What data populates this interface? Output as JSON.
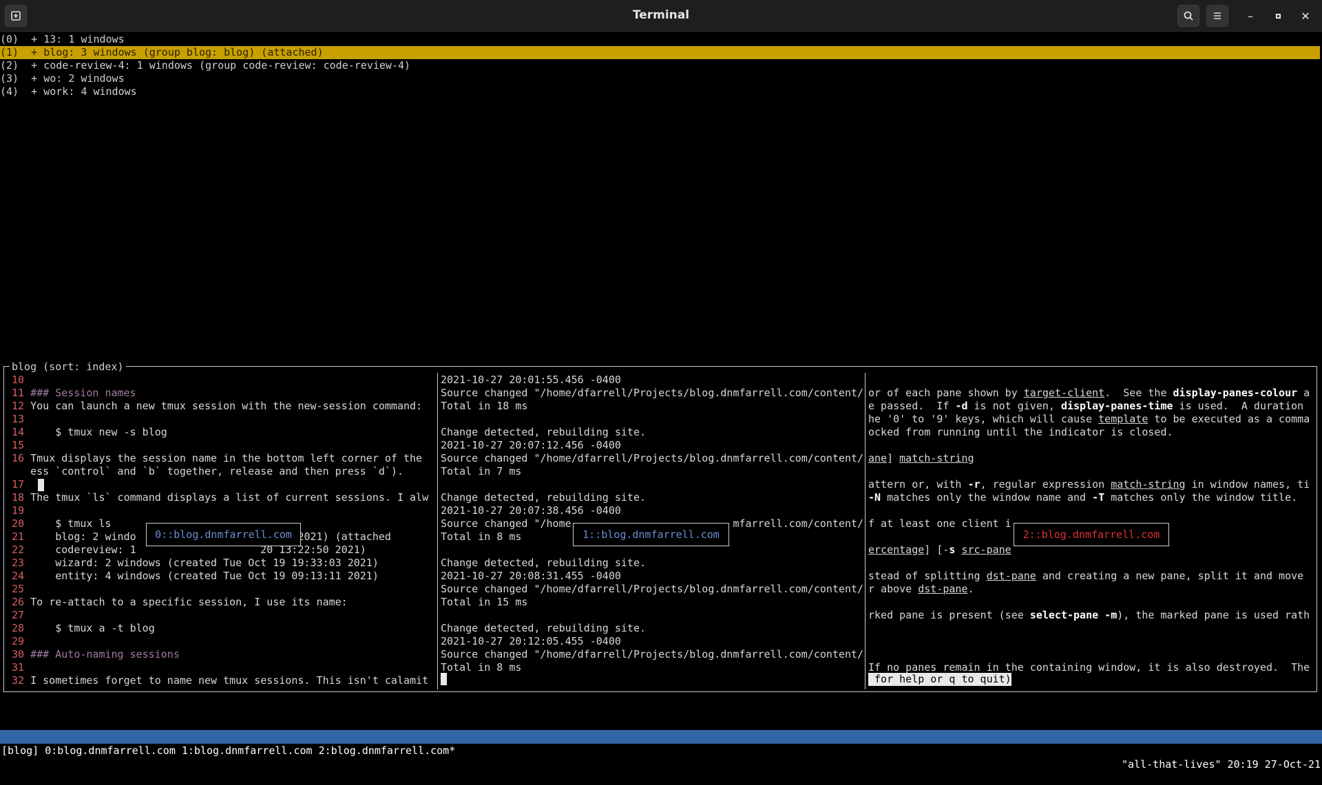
{
  "window": {
    "title": "Terminal"
  },
  "session_tree": [
    "(0)  + 13: 1 windows",
    "(1)  + blog: 3 windows (group blog: blog) (attached)",
    "(2)  + code-review-4: 1 windows (group code-review: code-review-4)",
    "(3)  + wo: 2 windows",
    "(4)  + work: 4 windows"
  ],
  "preview_title": "blog (sort: index)",
  "pane1": {
    "lines": [
      {
        "n": "10",
        "t": ""
      },
      {
        "n": "11",
        "t": "### Session names",
        "cls": "hd"
      },
      {
        "n": "12",
        "t": "You can launch a new tmux session with the new-session command:"
      },
      {
        "n": "13",
        "t": ""
      },
      {
        "n": "14",
        "t": "    $ tmux new -s blog"
      },
      {
        "n": "15",
        "t": ""
      },
      {
        "n": "16",
        "t": "Tmux displays the session name in the bottom left corner of the"
      },
      {
        "n": "",
        "t": "ess `control` and `b` together, release and then press `d`)."
      },
      {
        "n": "17",
        "t": ""
      },
      {
        "n": "18",
        "t": "The tmux `ls` command displays a list of current sessions. I alw"
      },
      {
        "n": "19",
        "t": ""
      },
      {
        "n": "20",
        "t": "    $ tmux ls"
      },
      {
        "n": "21",
        "t": "    blog: 2 windo                    32:56 2021) (attached"
      },
      {
        "n": "22",
        "t": "    codereview: 1                    20 13:22:50 2021)"
      },
      {
        "n": "23",
        "t": "    wizard: 2 windows (created Tue Oct 19 19:33:03 2021)"
      },
      {
        "n": "24",
        "t": "    entity: 4 windows (created Tue Oct 19 09:13:11 2021)"
      },
      {
        "n": "25",
        "t": ""
      },
      {
        "n": "26",
        "t": "To re-attach to a specific session, I use its name:"
      },
      {
        "n": "27",
        "t": ""
      },
      {
        "n": "28",
        "t": "    $ tmux a -t blog"
      },
      {
        "n": "29",
        "t": ""
      },
      {
        "n": "30",
        "t": "### Auto-naming sessions",
        "cls": "hd"
      },
      {
        "n": "31",
        "t": ""
      },
      {
        "n": "32",
        "t": "I sometimes forget to name new tmux sessions. This isn't calamit"
      }
    ],
    "label": "0::blog.dnmfarrell.com"
  },
  "pane2": {
    "lines": [
      "2021-10-27 20:01:55.456 -0400",
      "Source changed \"/home/dfarrell/Projects/blog.dnmfarrell.com/content/",
      "Total in 18 ms",
      "",
      "Change detected, rebuilding site.",
      "2021-10-27 20:07:12.456 -0400",
      "Source changed \"/home/dfarrell/Projects/blog.dnmfarrell.com/content/",
      "Total in 7 ms",
      "",
      "Change detected, rebuilding site.",
      "2021-10-27 20:07:38.456 -0400",
      "Source changed \"/home                          mfarrell.com/content/",
      "Total in 8 ms",
      "",
      "Change detected, rebuilding site.",
      "2021-10-27 20:08:31.455 -0400",
      "Source changed \"/home/dfarrell/Projects/blog.dnmfarrell.com/content/",
      "Total in 15 ms",
      "",
      "Change detected, rebuilding site.",
      "2021-10-27 20:12:05.455 -0400",
      "Source changed \"/home/dfarrell/Projects/blog.dnmfarrell.com/content/",
      "Total in 8 ms"
    ],
    "label": "1::blog.dnmfarrell.com"
  },
  "pane3": {
    "lines": [
      [
        {
          "t": ""
        }
      ],
      [
        {
          "t": "or of each pane shown by "
        },
        {
          "t": "target-client",
          "s": "u"
        },
        {
          "t": ".  See the "
        },
        {
          "t": "display-panes-colour",
          "s": "b"
        },
        {
          "t": " a"
        }
      ],
      [
        {
          "t": "e passed.  If "
        },
        {
          "t": "-d",
          "s": "b"
        },
        {
          "t": " is not given, "
        },
        {
          "t": "display-panes-time",
          "s": "b"
        },
        {
          "t": " is used.  A duration"
        }
      ],
      [
        {
          "t": "he '0' to '9' keys, which will cause "
        },
        {
          "t": "template",
          "s": "u"
        },
        {
          "t": " to be executed as a comma"
        }
      ],
      [
        {
          "t": "ocked from running until the indicator is closed."
        }
      ],
      [
        {
          "t": ""
        }
      ],
      [
        {
          "t": "ane",
          "s": "u"
        },
        {
          "t": "] "
        },
        {
          "t": "match-string",
          "s": "u"
        }
      ],
      [
        {
          "t": ""
        }
      ],
      [
        {
          "t": "attern or, with "
        },
        {
          "t": "-r",
          "s": "b"
        },
        {
          "t": ", regular expression "
        },
        {
          "t": "match-string",
          "s": "u"
        },
        {
          "t": " in window names, ti"
        }
      ],
      [
        {
          "t": "-N",
          "s": "b"
        },
        {
          "t": " matches only the window name and "
        },
        {
          "t": "-T",
          "s": "b"
        },
        {
          "t": " matches only the window title."
        }
      ],
      [
        {
          "t": ""
        }
      ],
      [
        {
          "t": "f at least one client i"
        }
      ],
      [
        {
          "t": ""
        }
      ],
      [
        {
          "t": "ercentage",
          "s": "u"
        },
        {
          "t": "] [-"
        },
        {
          "t": "s",
          "s": "b"
        },
        {
          "t": " "
        },
        {
          "t": "src-pane",
          "s": "u"
        }
      ],
      [
        {
          "t": ""
        }
      ],
      [
        {
          "t": "stead of splitting "
        },
        {
          "t": "dst-pane",
          "s": "u"
        },
        {
          "t": " and creating a new pane, split it and move"
        }
      ],
      [
        {
          "t": "r above "
        },
        {
          "t": "dst-pane",
          "s": "u"
        },
        {
          "t": "."
        }
      ],
      [
        {
          "t": ""
        }
      ],
      [
        {
          "t": "rked pane is present (see "
        },
        {
          "t": "select-pane -m",
          "s": "b"
        },
        {
          "t": "), the marked pane is used rath"
        }
      ],
      [
        {
          "t": ""
        }
      ],
      [
        {
          "t": ""
        }
      ],
      [
        {
          "t": ""
        }
      ],
      [
        {
          "t": "If no panes remain in the containing window, it is also destroyed.  The"
        }
      ]
    ],
    "prompt": " for help or q to quit)",
    "label": "2::blog.dnmfarrell.com"
  },
  "statusbar": {
    "left": "[blog] 0:blog.dnmfarrell.com 1:blog.dnmfarrell.com 2:blog.dnmfarrell.com*",
    "right": "\"all-that-lives\" 20:19 27-Oct-21"
  },
  "colors": {
    "highlight": "#c8a000",
    "status_bg": "#3465a4",
    "label2": "#e03030",
    "label": "#6a8ed0"
  },
  "icons": [
    "new-tab-icon",
    "search-icon",
    "menu-icon",
    "minimize-icon",
    "maximize-icon",
    "close-icon"
  ]
}
